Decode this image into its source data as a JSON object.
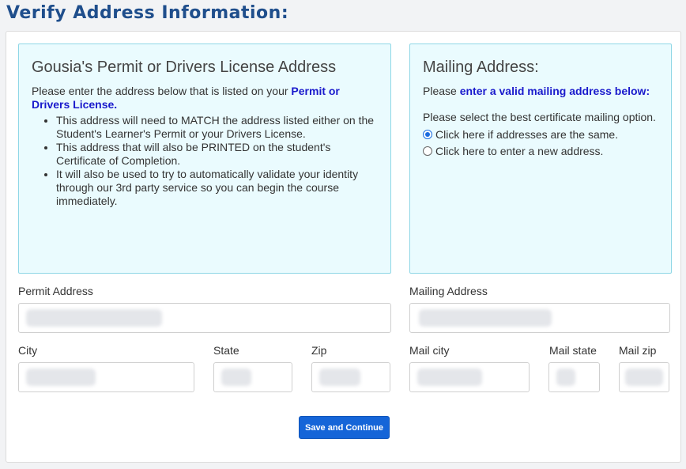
{
  "page": {
    "title": "Verify Address Information:"
  },
  "permit_box": {
    "heading": "Gousia's Permit or Drivers License Address",
    "intro_text": "Please enter the address below that is listed on your ",
    "intro_accent": "Permit or Drivers License.",
    "bullets": [
      "This address will need to MATCH the address listed either on the Student's Learner's Permit or your Drivers License.",
      "This address that will also be PRINTED on the student's Certificate of Completion.",
      "It will also be used to try to automatically validate your identity through our 3rd party service so you can begin the course immediately."
    ]
  },
  "mailing_box": {
    "heading": "Mailing Address:",
    "prompt_text": "Please ",
    "prompt_accent": "enter a valid mailing address below:",
    "select_text": "Please select the best certificate mailing option.",
    "options": [
      {
        "label": "Click here if addresses are the same.",
        "selected": true
      },
      {
        "label": "Click here to enter a new address.",
        "selected": false
      }
    ]
  },
  "form": {
    "permit_address_label": "Permit Address",
    "mailing_address_label": "Mailing Address",
    "city_label": "City",
    "state_label": "State",
    "zip_label": "Zip",
    "mail_city_label": "Mail city",
    "mail_state_label": "Mail state",
    "mail_zip_label": "Mail zip"
  },
  "actions": {
    "save_label": "Save and Continue"
  },
  "colors": {
    "title": "#1f4e8c",
    "info_bg": "#eafbfe",
    "info_border": "#8fd7e6",
    "accent_link": "#1a1acc",
    "button": "#1565d8"
  }
}
